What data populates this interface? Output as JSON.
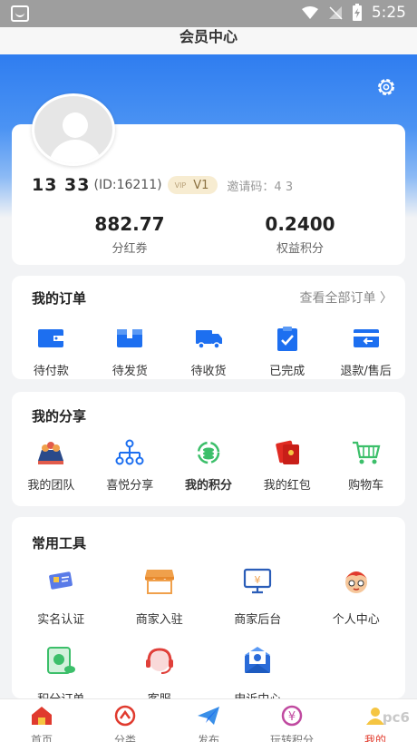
{
  "status_bar": {
    "time": "5:25"
  },
  "header": {
    "title": "会员中心"
  },
  "profile": {
    "phone": "13        33",
    "id_text": "(ID:16211)",
    "vip_small": "VIP",
    "vip_level": "V1",
    "invite_text": "邀请码：4      3",
    "stats": [
      {
        "value": "882.77",
        "label": "分红券"
      },
      {
        "value": "0.2400",
        "label": "权益积分"
      }
    ]
  },
  "orders": {
    "title": "我的订单",
    "view_all": "查看全部订单 〉",
    "items": [
      {
        "label": "待付款",
        "icon": "wallet-icon"
      },
      {
        "label": "待发货",
        "icon": "box-icon"
      },
      {
        "label": "待收货",
        "icon": "truck-icon"
      },
      {
        "label": "已完成",
        "icon": "clipboard-check-icon"
      },
      {
        "label": "退款/售后",
        "icon": "refund-card-icon"
      }
    ]
  },
  "share": {
    "title": "我的分享",
    "items": [
      {
        "label": "我的团队",
        "icon": "team-icon"
      },
      {
        "label": "喜悦分享",
        "icon": "share-tree-icon"
      },
      {
        "label": "我的积分",
        "icon": "points-icon"
      },
      {
        "label": "我的红包",
        "icon": "red-envelope-icon"
      },
      {
        "label": "购物车",
        "icon": "cart-icon"
      }
    ]
  },
  "tools": {
    "title": "常用工具",
    "items": [
      {
        "label": "实名认证",
        "icon": "id-card-icon"
      },
      {
        "label": "商家入驻",
        "icon": "storefront-icon"
      },
      {
        "label": "商家后台",
        "icon": "monitor-icon"
      },
      {
        "label": "个人中心",
        "icon": "character-icon"
      },
      {
        "label": "积分订单",
        "icon": "points-order-icon"
      },
      {
        "label": "客服",
        "icon": "headset-icon"
      },
      {
        "label": "申诉中心",
        "icon": "appeal-mail-icon"
      }
    ]
  },
  "tabbar": {
    "items": [
      {
        "label": "首页",
        "icon": "home-icon"
      },
      {
        "label": "分类",
        "icon": "category-icon"
      },
      {
        "label": "发布",
        "icon": "paper-plane-icon"
      },
      {
        "label": "玩转积分",
        "icon": "yen-icon"
      },
      {
        "label": "我的",
        "icon": "user-icon",
        "active": true
      }
    ]
  },
  "watermark": "pc6",
  "colors": {
    "accent": "#2f7df0",
    "active_tab": "#e23b2c",
    "vip_bg": "#f7ecd1"
  }
}
